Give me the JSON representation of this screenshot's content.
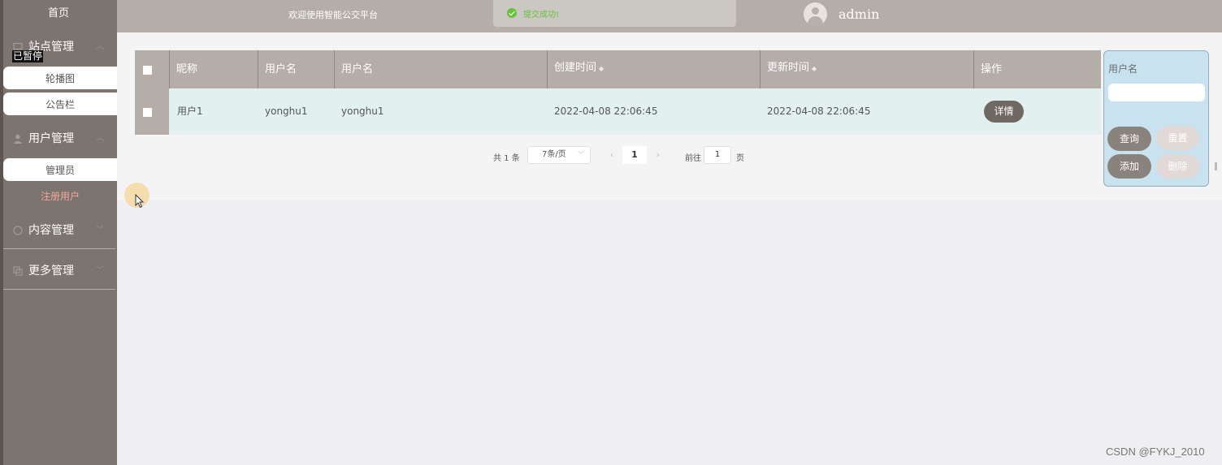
{
  "sidebar": {
    "home": "首页",
    "paused": "已暂停",
    "groups": [
      {
        "label": "站点管理",
        "icon": "monitor-icon",
        "items": [
          "轮播图",
          "公告栏"
        ]
      },
      {
        "label": "用户管理",
        "icon": "user-icon",
        "items": [
          "管理员",
          "注册用户"
        ]
      },
      {
        "label": "内容管理",
        "icon": "chat-icon",
        "items": []
      },
      {
        "label": "更多管理",
        "icon": "copy-icon",
        "items": []
      }
    ]
  },
  "header": {
    "welcome": "欢迎使用智能公交平台",
    "toast": "提交成功!",
    "username": "admin"
  },
  "table": {
    "columns": [
      "昵称",
      "用户名",
      "用户名",
      "创建时间",
      "更新时间",
      "操作"
    ],
    "rows": [
      {
        "nickname": "用户1",
        "username": "yonghu1",
        "username2": "yonghu1",
        "created": "2022-04-08 22:06:45",
        "updated": "2022-04-08 22:06:45",
        "action": "详情"
      }
    ]
  },
  "pagination": {
    "total": "共 1 条",
    "page_size": "7条/页",
    "current": "1",
    "goto_label": "前往",
    "goto_value": "1",
    "page_suffix": "页"
  },
  "search": {
    "label": "用户名",
    "value": "",
    "buttons": {
      "query": "查询",
      "reset": "重置",
      "add": "添加",
      "delete": "删除"
    }
  },
  "watermark": "CSDN @FYKJ_2010"
}
